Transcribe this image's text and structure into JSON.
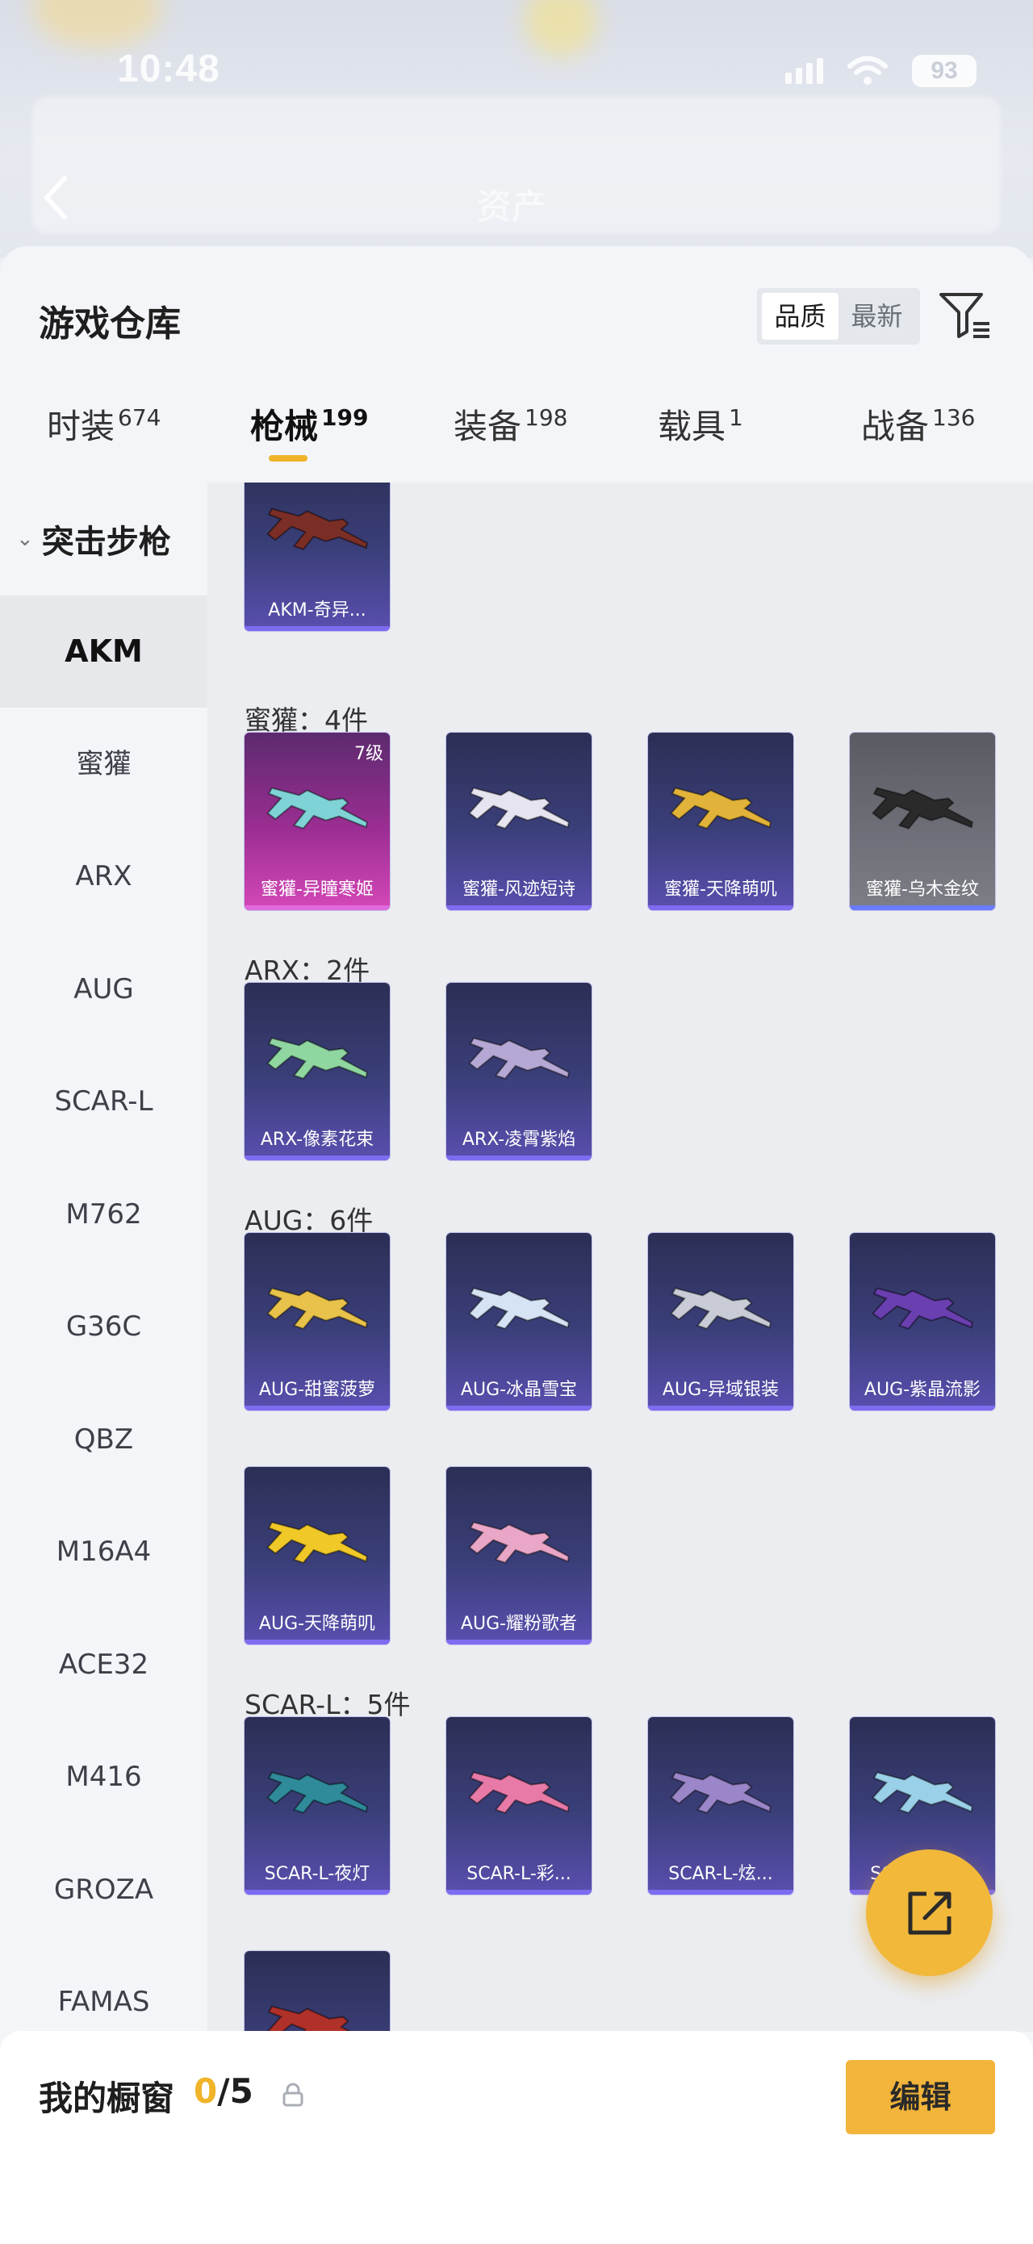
{
  "status": {
    "time": "10:48",
    "battery": "93"
  },
  "background": {
    "title": "资产"
  },
  "sheet": {
    "title": "游戏仓库",
    "sort": {
      "options": [
        "品质",
        "最新"
      ],
      "active": 0
    },
    "tabs": [
      {
        "label": "时装",
        "count": "674"
      },
      {
        "label": "枪械",
        "count": "199"
      },
      {
        "label": "装备",
        "count": "198"
      },
      {
        "label": "载具",
        "count": "1"
      },
      {
        "label": "战备",
        "count": "136"
      }
    ],
    "active_tab": 1
  },
  "sidebar": {
    "category": "突击步枪",
    "items": [
      "AKM",
      "蜜獾",
      "ARX",
      "AUG",
      "SCAR-L",
      "M762",
      "G36C",
      "QBZ",
      "M16A4",
      "ACE32",
      "M416",
      "GROZA",
      "FAMAS"
    ],
    "active": 0
  },
  "content": {
    "groups": [
      {
        "title": "",
        "items": [
          {
            "name": "AKM-奇异...",
            "style": "blue",
            "gun_color": "#7a2e26"
          }
        ]
      },
      {
        "title": "蜜獾：4件",
        "items": [
          {
            "name": "蜜獾-异瞳寒姬",
            "style": "pink",
            "level": "7级",
            "gun_color": "#7fd3d6"
          },
          {
            "name": "蜜獾-风迹短诗",
            "style": "blue",
            "gun_color": "#e6e4ee"
          },
          {
            "name": "蜜獾-天降萌叽",
            "style": "blue",
            "gun_color": "#e2b33a"
          },
          {
            "name": "蜜獾-乌木金纹",
            "style": "gray",
            "gun_color": "#2a2a2a"
          }
        ]
      },
      {
        "title": "ARX：2件",
        "items": [
          {
            "name": "ARX-像素花束",
            "style": "blue",
            "gun_color": "#8fd6a0"
          },
          {
            "name": "ARX-凌霄紫焰",
            "style": "blue",
            "gun_color": "#b6a8d4"
          }
        ]
      },
      {
        "title": "AUG：6件",
        "items": [
          {
            "name": "AUG-甜蜜菠萝",
            "style": "blue",
            "gun_color": "#e8c24a"
          },
          {
            "name": "AUG-冰晶雪宝",
            "style": "blue",
            "gun_color": "#d5e3f5"
          },
          {
            "name": "AUG-异域银装",
            "style": "blue",
            "gun_color": "#c9ccd6"
          },
          {
            "name": "AUG-紫晶流影",
            "style": "blue",
            "gun_color": "#6a3fb0"
          },
          {
            "name": "AUG-天降萌叽",
            "style": "blue",
            "gun_color": "#f0c828"
          },
          {
            "name": "AUG-耀粉歌者",
            "style": "blue",
            "gun_color": "#e9a6c6"
          }
        ]
      },
      {
        "title": "SCAR-L：5件",
        "items": [
          {
            "name": "SCAR-L-夜灯",
            "style": "blue",
            "gun_color": "#2f8a9a"
          },
          {
            "name": "SCAR-L-彩...",
            "style": "blue",
            "gun_color": "#e87aa8"
          },
          {
            "name": "SCAR-L-炫...",
            "style": "blue",
            "gun_color": "#9a86c8"
          },
          {
            "name": "SCAR-L-海...",
            "style": "blue",
            "gun_color": "#9ad0e8"
          },
          {
            "name": "",
            "style": "blue",
            "gun_color": "#b0302a"
          }
        ]
      }
    ]
  },
  "showcase": {
    "label": "我的橱窗",
    "current": "0",
    "total": "/5",
    "edit_label": "编辑"
  },
  "colors": {
    "accent": "#f0b429",
    "card_blue": "#3b3f7a",
    "card_pink": "#c23ea9"
  }
}
